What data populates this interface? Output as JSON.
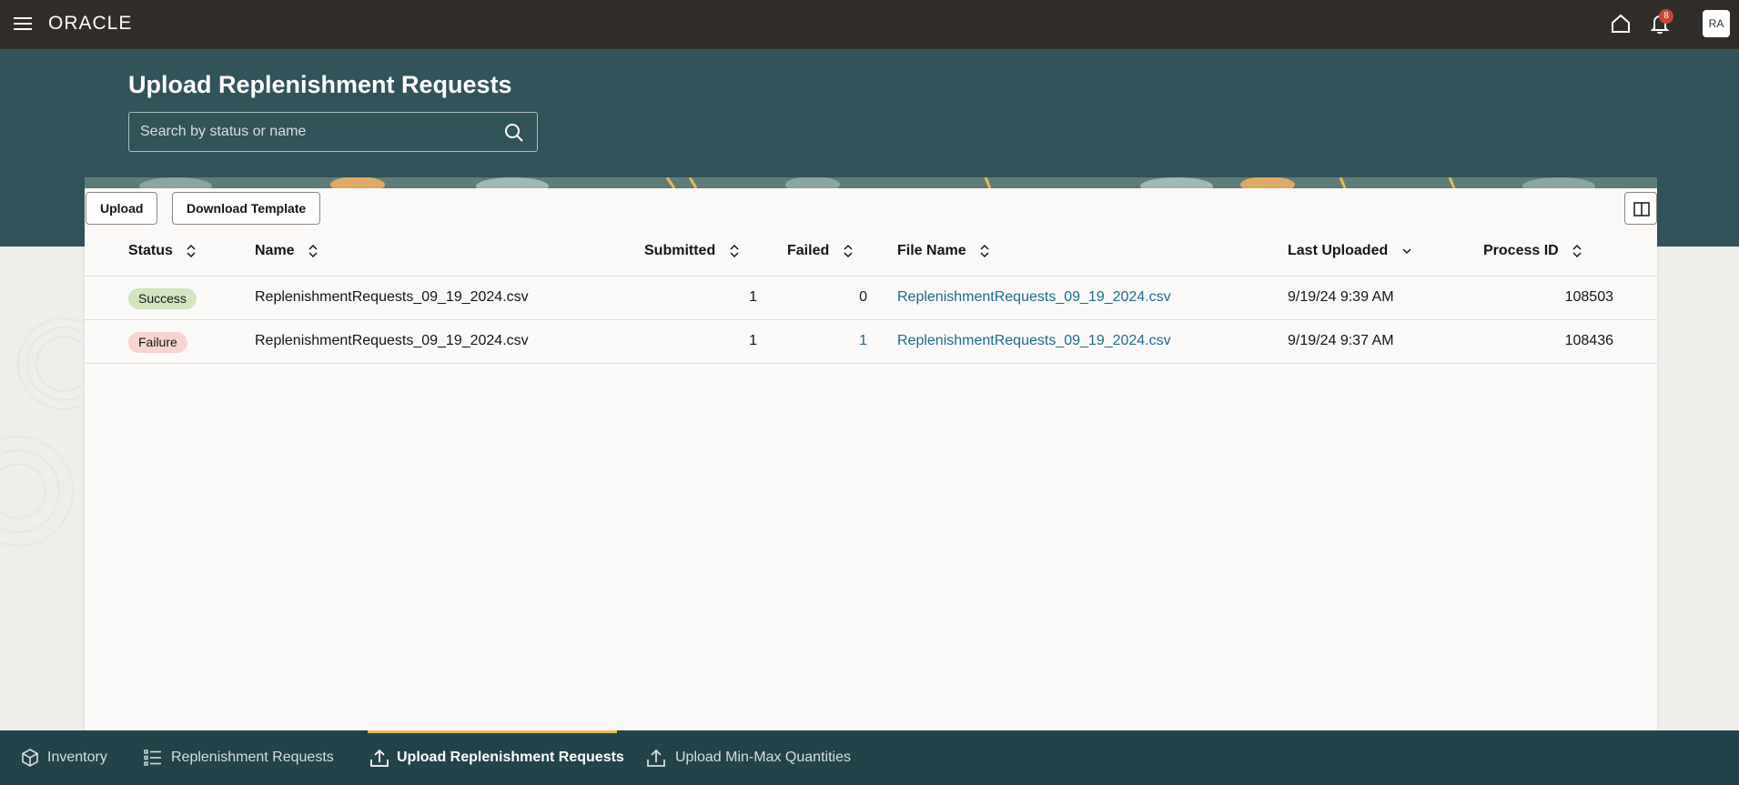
{
  "header": {
    "logo": "ORACLE",
    "notification_count": "8",
    "avatar_initials": "RA"
  },
  "page": {
    "title": "Upload Replenishment Requests",
    "search_placeholder": "Search by status or name"
  },
  "toolbar": {
    "upload_label": "Upload",
    "download_template_label": "Download Template"
  },
  "table": {
    "columns": [
      "Status",
      "Name",
      "Submitted",
      "Failed",
      "File Name",
      "Last Uploaded",
      "Process ID"
    ],
    "rows": [
      {
        "status": "Success",
        "name": "ReplenishmentRequests_09_19_2024.csv",
        "submitted": "1",
        "failed": "0",
        "file_name": "ReplenishmentRequests_09_19_2024.csv",
        "last_uploaded": "9/19/24 9:39 AM",
        "process_id": "108503"
      },
      {
        "status": "Failure",
        "name": "ReplenishmentRequests_09_19_2024.csv",
        "submitted": "1",
        "failed": "1",
        "file_name": "ReplenishmentRequests_09_19_2024.csv",
        "last_uploaded": "9/19/24 9:37 AM",
        "process_id": "108436"
      }
    ]
  },
  "bottom_nav": {
    "items": [
      {
        "label": "Inventory",
        "icon": "cube-icon"
      },
      {
        "label": "Replenishment Requests",
        "icon": "list-icon"
      },
      {
        "label": "Upload Replenishment Requests",
        "icon": "upload-icon",
        "active": true
      },
      {
        "label": "Upload Min-Max Quantities",
        "icon": "upload-icon"
      }
    ]
  },
  "colors": {
    "header_bg": "#312d2a",
    "hero_bg": "#31535a",
    "bottom_nav_bg": "#224349",
    "active_accent": "#e7b957",
    "link": "#1d6b8a",
    "success_badge": "#d1e6bf",
    "failure_badge": "#f7d4d0"
  }
}
